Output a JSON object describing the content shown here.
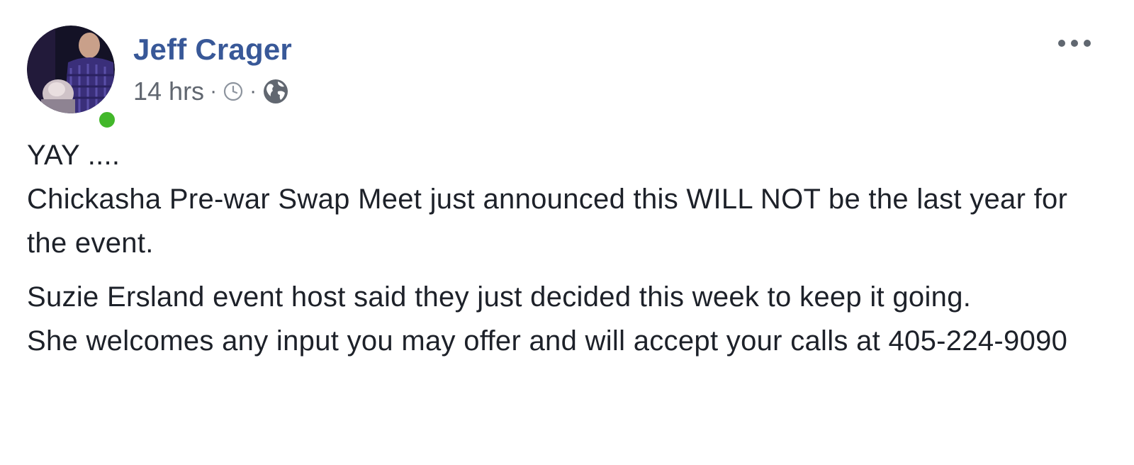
{
  "post": {
    "author": "Jeff Crager",
    "timestamp": "14 hrs",
    "separator": "·",
    "audience_icon": "globe-icon",
    "scheduled_icon": "clock-icon",
    "more_icon": "ellipsis-icon",
    "online": true,
    "colors": {
      "name": "#385898",
      "meta": "#616770",
      "text": "#1d2129",
      "online": "#42b72a"
    },
    "paragraphs": [
      "YAY ....\nChickasha Pre-war Swap Meet just announced this WILL NOT be the last year for the event.",
      "Suzie Ersland event host said they just decided this week to keep it going.\nShe welcomes any input you may offer and will accept your calls at 405-224-9090"
    ]
  }
}
